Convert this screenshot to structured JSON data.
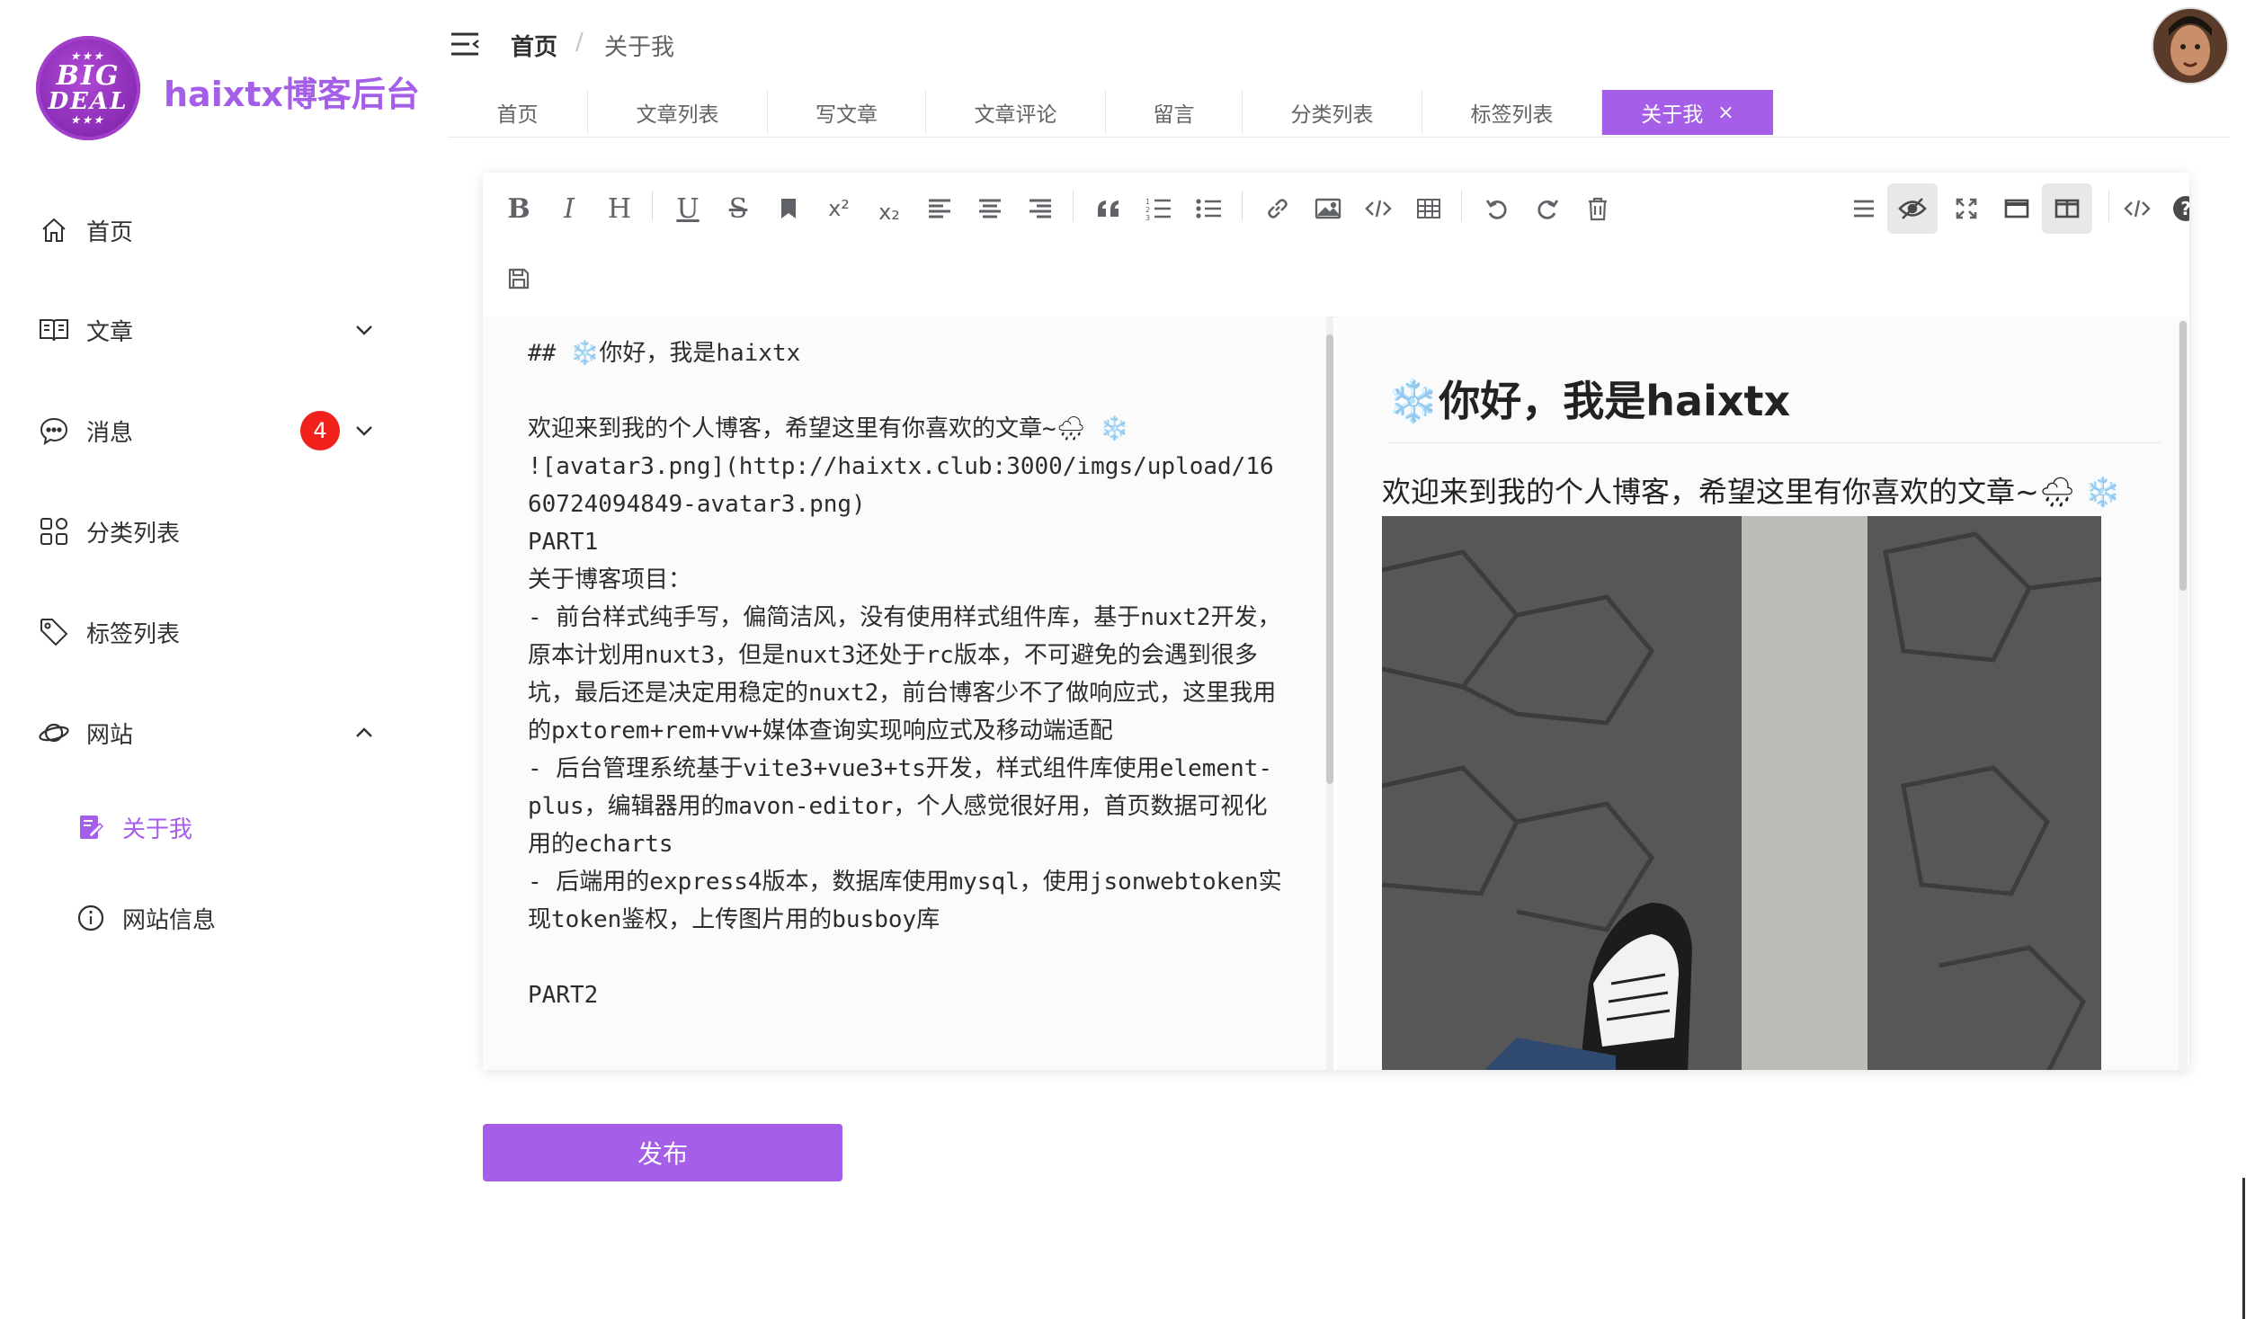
{
  "brand": {
    "logo_line1": "BIG",
    "logo_line2": "DEAL",
    "logo_stars": "★★★",
    "title": "haixtx博客后台"
  },
  "sidebar": {
    "items": [
      {
        "label": "首页",
        "icon": "home-icon"
      },
      {
        "label": "文章",
        "icon": "book-icon"
      },
      {
        "label": "消息",
        "icon": "chat-icon",
        "badge": "4"
      },
      {
        "label": "分类列表",
        "icon": "grid-icon"
      },
      {
        "label": "标签列表",
        "icon": "tag-icon"
      },
      {
        "label": "网站",
        "icon": "planet-icon"
      }
    ],
    "sub_items": [
      {
        "label": "关于我",
        "icon": "edit-doc-icon",
        "active": true
      },
      {
        "label": "网站信息",
        "icon": "info-icon"
      }
    ]
  },
  "header": {
    "breadcrumb": [
      "首页",
      "关于我"
    ],
    "separator": "/"
  },
  "tabs": [
    {
      "label": "首页"
    },
    {
      "label": "文章列表"
    },
    {
      "label": "写文章"
    },
    {
      "label": "文章评论"
    },
    {
      "label": "留言"
    },
    {
      "label": "分类列表"
    },
    {
      "label": "标签列表"
    },
    {
      "label": "关于我",
      "active": true,
      "close": "×"
    }
  ],
  "toolbar": {
    "bold": "B",
    "italic": "I",
    "heading": "H",
    "underline": "U",
    "strike": "S",
    "superscript": "x²",
    "subscript": "x₂"
  },
  "editor": {
    "source": "## ❄️你好，我是haixtx\n\n欢迎来到我的个人博客，希望这里有你喜欢的文章~🌧 ❄️\n![avatar3.png](http://haixtx.club:3000/imgs/upload/1660724094849-avatar3.png)\nPART1\n关于博客项目：\n- 前台样式纯手写，偏简洁风，没有使用样式组件库，基于nuxt2开发，原本计划用nuxt3，但是nuxt3还处于rc版本，不可避免的会遇到很多坑，最后还是决定用稳定的nuxt2，前台博客少不了做响应式，这里我用的pxtorem+rem+vw+媒体查询实现响应式及移动端适配\n- 后台管理系统基于vite3+vue3+ts开发，样式组件库使用element-plus，编辑器用的mavon-editor，个人感觉很好用，首页数据可视化用的echarts\n- 后端用的express4版本，数据库使用mysql，使用jsonwebtoken实现token鉴权，上传图片用的busboy库\n\nPART2"
  },
  "preview": {
    "heading_emoji": "❄️",
    "heading": "你好，我是haixtx",
    "paragraph": "欢迎来到我的个人博客，希望这里有你喜欢的文章~🌧 ❄️"
  },
  "publish": {
    "label": "发布"
  },
  "colors": {
    "accent": "#a55ee8",
    "badge": "#f0201b",
    "text": "#303133"
  }
}
